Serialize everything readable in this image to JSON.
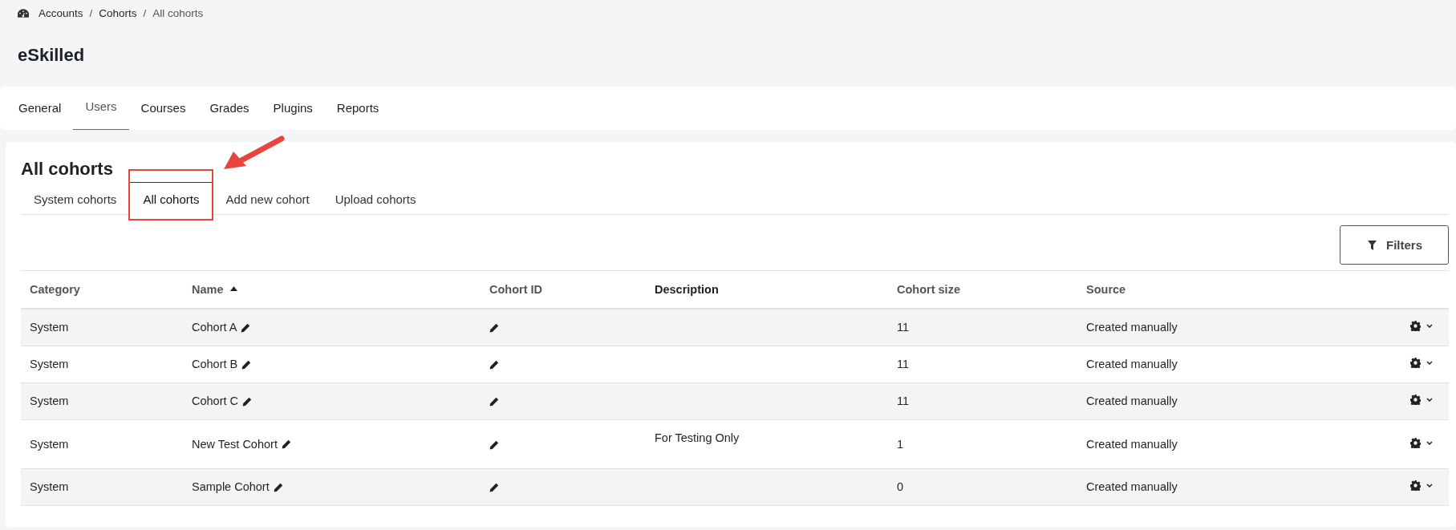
{
  "breadcrumb": [
    "Accounts",
    "Cohorts",
    "All cohorts"
  ],
  "breadcrumb_separator": "/",
  "site_title": "eSkilled",
  "primary_tabs": [
    {
      "label": "General",
      "selected": false
    },
    {
      "label": "Users",
      "selected": true
    },
    {
      "label": "Courses",
      "selected": false
    },
    {
      "label": "Grades",
      "selected": false
    },
    {
      "label": "Plugins",
      "selected": false
    },
    {
      "label": "Reports",
      "selected": false
    }
  ],
  "page_heading": "All cohorts",
  "secondary_tabs": [
    {
      "label": "System cohorts",
      "selected": false,
      "highlighted": false
    },
    {
      "label": "All cohorts",
      "selected": true,
      "highlighted": true
    },
    {
      "label": "Add new cohort",
      "selected": false,
      "highlighted": false
    },
    {
      "label": "Upload cohorts",
      "selected": false,
      "highlighted": false
    }
  ],
  "filters_button": "Filters",
  "table": {
    "columns": [
      {
        "label": "Category",
        "sortable": true,
        "sorted": false
      },
      {
        "label": "Name",
        "sortable": true,
        "sorted": true
      },
      {
        "label": "Cohort ID",
        "sortable": true,
        "sorted": false
      },
      {
        "label": "Description",
        "sortable": false,
        "sorted": false
      },
      {
        "label": "Cohort size",
        "sortable": true,
        "sorted": false
      },
      {
        "label": "Source",
        "sortable": true,
        "sorted": false
      }
    ],
    "rows": [
      {
        "category": "System",
        "name": "Cohort A",
        "size": "11",
        "source": "Created manually"
      },
      {
        "category": "System",
        "name": "Cohort B",
        "size": "11",
        "source": "Created manually"
      },
      {
        "category": "System",
        "name": "Cohort C",
        "size": "11",
        "source": "Created manually"
      },
      {
        "category": "System",
        "name": "New Test Cohort",
        "description": "For Testing Only",
        "size": "1",
        "source": "Created manually"
      },
      {
        "category": "System",
        "name": "Sample Cohort",
        "size": "0",
        "source": "Created manually"
      }
    ]
  }
}
